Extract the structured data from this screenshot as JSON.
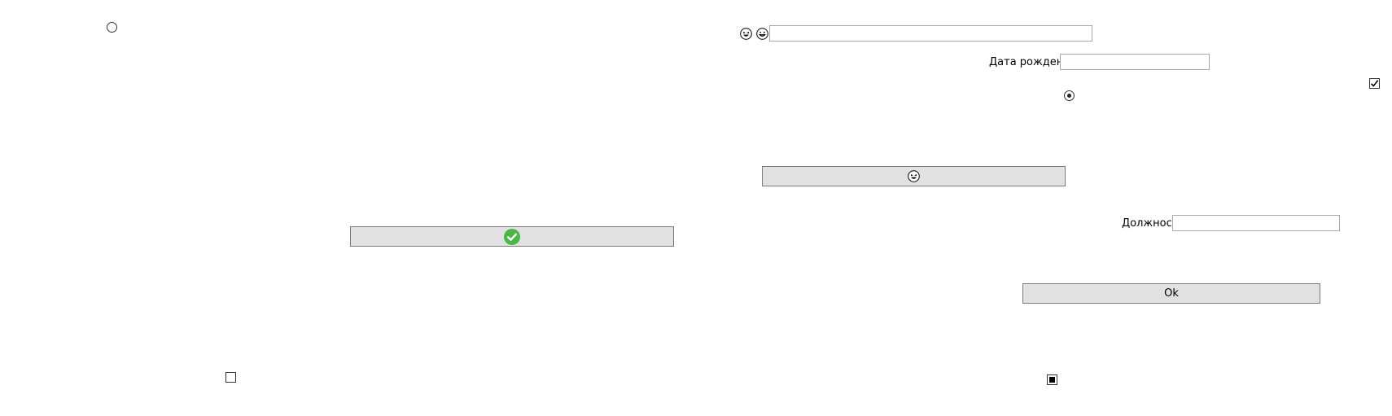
{
  "left_panel": {
    "radio_unchecked": {
      "checked": false
    },
    "ok_icon_button": {
      "icon": "check-circle-green-icon",
      "accent": "#4CB648"
    },
    "checkbox_unchecked": {
      "checked": false
    }
  },
  "right_panel": {
    "top_row": {
      "icons": [
        "laughing-face-icon",
        "grinning-face-icon"
      ],
      "text_input_value": ""
    },
    "birth_date": {
      "label": "Дата рождения",
      "value": ""
    },
    "checkbox_checked": {
      "checked": true
    },
    "radio_selected": {
      "checked": true
    },
    "emoji_button": {
      "icon": "laughing-face-icon"
    },
    "position": {
      "label": "Должность",
      "value": ""
    },
    "ok_button": {
      "label": "Ok"
    },
    "checkbox_indeterminate": {
      "state": "indeterminate"
    }
  },
  "colors": {
    "button_bg": "#E1E1E1",
    "button_border": "#7A7A7A",
    "input_border": "#A9A9A9",
    "check_green": "#4CB648"
  }
}
